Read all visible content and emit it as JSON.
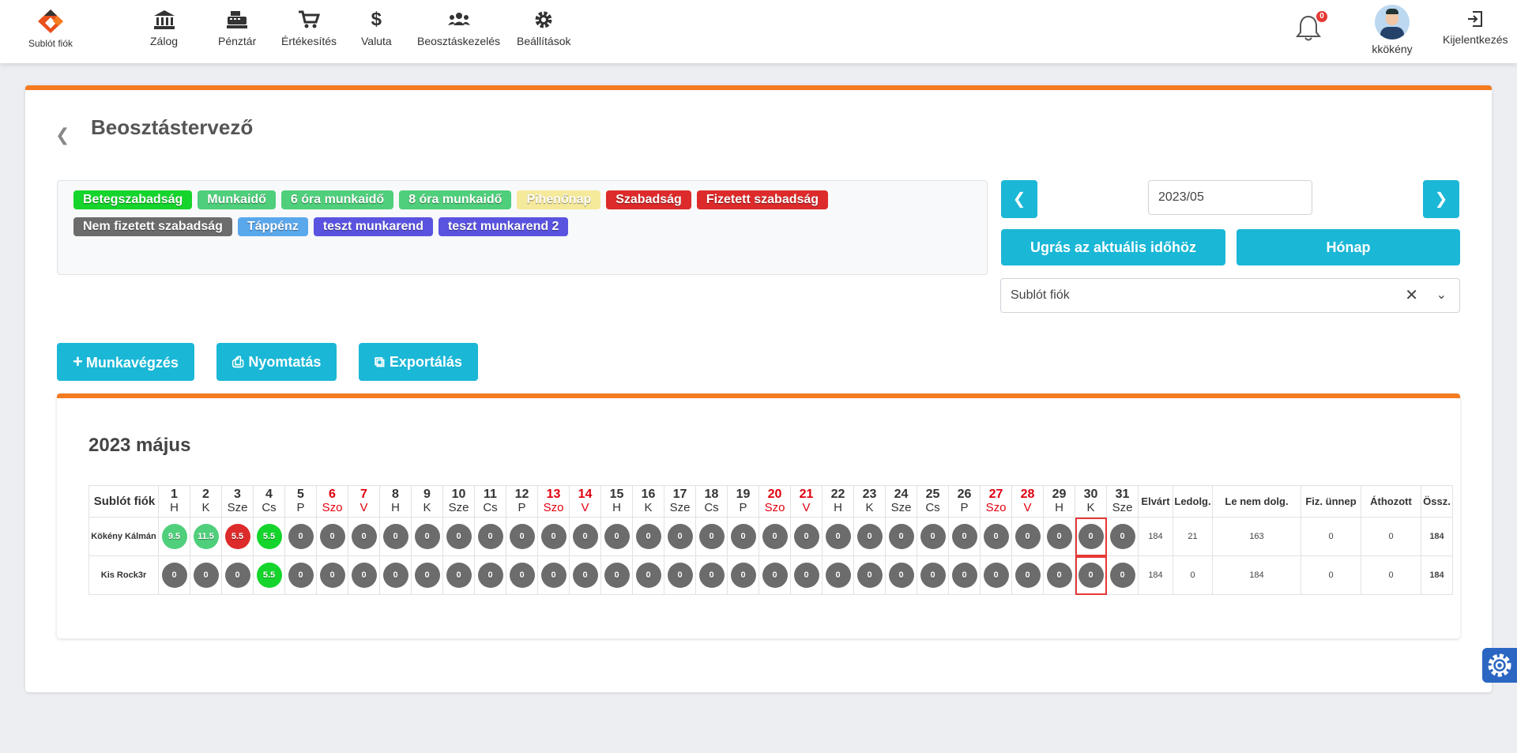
{
  "brand": {
    "label": "Sublót fiók"
  },
  "nav": [
    {
      "label": "Zálog",
      "icon": "bank-icon"
    },
    {
      "label": "Pénztár",
      "icon": "cash-register-icon"
    },
    {
      "label": "Értékesítés",
      "icon": "cart-icon"
    },
    {
      "label": "Valuta",
      "icon": "dollar-icon"
    },
    {
      "label": "Beosztáskezelés",
      "icon": "users-icon"
    },
    {
      "label": "Beállítások",
      "icon": "gear-icon"
    }
  ],
  "notifications": {
    "count": "0"
  },
  "user": {
    "name": "kkökény"
  },
  "logout": {
    "label": "Kijelentkezés"
  },
  "page": {
    "title": "Beosztástervező"
  },
  "legend": {
    "row1": [
      {
        "label": "Betegszabadság",
        "color": "#15d52c"
      },
      {
        "label": "Munkaidő",
        "color": "#4fcf7b"
      },
      {
        "label": "6 óra munkaidő",
        "color": "#4fcf7b"
      },
      {
        "label": "8 óra munkaidő",
        "color": "#4fcf7b"
      },
      {
        "label": "Pihenőnap",
        "color": "#f5e99b"
      },
      {
        "label": "Szabadság",
        "color": "#dd2a2a"
      },
      {
        "label": "Fizetett szabadság",
        "color": "#dd2a2a"
      }
    ],
    "row2": [
      {
        "label": "Nem fizetett szabadság",
        "color": "#6c6c6c"
      },
      {
        "label": "Táppénz",
        "color": "#5aa8ec"
      },
      {
        "label": "teszt munkarend",
        "color": "#5a53e0"
      },
      {
        "label": "teszt munkarend 2",
        "color": "#5a53e0"
      }
    ]
  },
  "period": {
    "value": "2023/05",
    "jump_label": "Ugrás az aktuális időhöz",
    "view_label": "Hónap"
  },
  "branch_select": {
    "value": "Sublót fiók"
  },
  "actions": {
    "work_label": "Munkavégzés",
    "print_label": "Nyomtatás",
    "export_label": "Exportálás"
  },
  "schedule": {
    "title": "2023 május",
    "branch_header": "Sublót fiók",
    "days": [
      {
        "n": "1",
        "w": "H",
        "we": false
      },
      {
        "n": "2",
        "w": "K",
        "we": false
      },
      {
        "n": "3",
        "w": "Sze",
        "we": false
      },
      {
        "n": "4",
        "w": "Cs",
        "we": false
      },
      {
        "n": "5",
        "w": "P",
        "we": false
      },
      {
        "n": "6",
        "w": "Szo",
        "we": true
      },
      {
        "n": "7",
        "w": "V",
        "we": true
      },
      {
        "n": "8",
        "w": "H",
        "we": false
      },
      {
        "n": "9",
        "w": "K",
        "we": false
      },
      {
        "n": "10",
        "w": "Sze",
        "we": false
      },
      {
        "n": "11",
        "w": "Cs",
        "we": false
      },
      {
        "n": "12",
        "w": "P",
        "we": false
      },
      {
        "n": "13",
        "w": "Szo",
        "we": true
      },
      {
        "n": "14",
        "w": "V",
        "we": true
      },
      {
        "n": "15",
        "w": "H",
        "we": false
      },
      {
        "n": "16",
        "w": "K",
        "we": false
      },
      {
        "n": "17",
        "w": "Sze",
        "we": false
      },
      {
        "n": "18",
        "w": "Cs",
        "we": false
      },
      {
        "n": "19",
        "w": "P",
        "we": false
      },
      {
        "n": "20",
        "w": "Szo",
        "we": true
      },
      {
        "n": "21",
        "w": "V",
        "we": true
      },
      {
        "n": "22",
        "w": "H",
        "we": false
      },
      {
        "n": "23",
        "w": "K",
        "we": false
      },
      {
        "n": "24",
        "w": "Sze",
        "we": false
      },
      {
        "n": "25",
        "w": "Cs",
        "we": false
      },
      {
        "n": "26",
        "w": "P",
        "we": false
      },
      {
        "n": "27",
        "w": "Szo",
        "we": true
      },
      {
        "n": "28",
        "w": "V",
        "we": true
      },
      {
        "n": "29",
        "w": "H",
        "we": false
      },
      {
        "n": "30",
        "w": "K",
        "we": false
      },
      {
        "n": "31",
        "w": "Sze",
        "we": false
      }
    ],
    "summary_headers": [
      "Elvárt",
      "Ledolg.",
      "Le nem dolg.",
      "Fiz. ünnep",
      "Áthozott",
      "Össz."
    ],
    "highlight_day": "30",
    "rows": [
      {
        "name": "Kökény Kálmán",
        "cells": [
          {
            "v": "9.5",
            "c": "#4fcf7b"
          },
          {
            "v": "11.5",
            "c": "#4fcf7b"
          },
          {
            "v": "5.5",
            "c": "#dd2a2a"
          },
          {
            "v": "5.5",
            "c": "#15d52c"
          },
          {
            "v": "0",
            "c": "#6c6c6c"
          },
          {
            "v": "0",
            "c": "#6c6c6c"
          },
          {
            "v": "0",
            "c": "#6c6c6c"
          },
          {
            "v": "0",
            "c": "#6c6c6c"
          },
          {
            "v": "0",
            "c": "#6c6c6c"
          },
          {
            "v": "0",
            "c": "#6c6c6c"
          },
          {
            "v": "0",
            "c": "#6c6c6c"
          },
          {
            "v": "0",
            "c": "#6c6c6c"
          },
          {
            "v": "0",
            "c": "#6c6c6c"
          },
          {
            "v": "0",
            "c": "#6c6c6c"
          },
          {
            "v": "0",
            "c": "#6c6c6c"
          },
          {
            "v": "0",
            "c": "#6c6c6c"
          },
          {
            "v": "0",
            "c": "#6c6c6c"
          },
          {
            "v": "0",
            "c": "#6c6c6c"
          },
          {
            "v": "0",
            "c": "#6c6c6c"
          },
          {
            "v": "0",
            "c": "#6c6c6c"
          },
          {
            "v": "0",
            "c": "#6c6c6c"
          },
          {
            "v": "0",
            "c": "#6c6c6c"
          },
          {
            "v": "0",
            "c": "#6c6c6c"
          },
          {
            "v": "0",
            "c": "#6c6c6c"
          },
          {
            "v": "0",
            "c": "#6c6c6c"
          },
          {
            "v": "0",
            "c": "#6c6c6c"
          },
          {
            "v": "0",
            "c": "#6c6c6c"
          },
          {
            "v": "0",
            "c": "#6c6c6c"
          },
          {
            "v": "0",
            "c": "#6c6c6c"
          },
          {
            "v": "0",
            "c": "#6c6c6c"
          },
          {
            "v": "0",
            "c": "#6c6c6c"
          }
        ],
        "summary": [
          "184",
          "21",
          "163",
          "0",
          "0",
          "184"
        ]
      },
      {
        "name": "Kis Rock3r",
        "cells": [
          {
            "v": "0",
            "c": "#6c6c6c"
          },
          {
            "v": "0",
            "c": "#6c6c6c"
          },
          {
            "v": "0",
            "c": "#6c6c6c"
          },
          {
            "v": "5.5",
            "c": "#15d52c"
          },
          {
            "v": "0",
            "c": "#6c6c6c"
          },
          {
            "v": "0",
            "c": "#6c6c6c"
          },
          {
            "v": "0",
            "c": "#6c6c6c"
          },
          {
            "v": "0",
            "c": "#6c6c6c"
          },
          {
            "v": "0",
            "c": "#6c6c6c"
          },
          {
            "v": "0",
            "c": "#6c6c6c"
          },
          {
            "v": "0",
            "c": "#6c6c6c"
          },
          {
            "v": "0",
            "c": "#6c6c6c"
          },
          {
            "v": "0",
            "c": "#6c6c6c"
          },
          {
            "v": "0",
            "c": "#6c6c6c"
          },
          {
            "v": "0",
            "c": "#6c6c6c"
          },
          {
            "v": "0",
            "c": "#6c6c6c"
          },
          {
            "v": "0",
            "c": "#6c6c6c"
          },
          {
            "v": "0",
            "c": "#6c6c6c"
          },
          {
            "v": "0",
            "c": "#6c6c6c"
          },
          {
            "v": "0",
            "c": "#6c6c6c"
          },
          {
            "v": "0",
            "c": "#6c6c6c"
          },
          {
            "v": "0",
            "c": "#6c6c6c"
          },
          {
            "v": "0",
            "c": "#6c6c6c"
          },
          {
            "v": "0",
            "c": "#6c6c6c"
          },
          {
            "v": "0",
            "c": "#6c6c6c"
          },
          {
            "v": "0",
            "c": "#6c6c6c"
          },
          {
            "v": "0",
            "c": "#6c6c6c"
          },
          {
            "v": "0",
            "c": "#6c6c6c"
          },
          {
            "v": "0",
            "c": "#6c6c6c"
          },
          {
            "v": "0",
            "c": "#6c6c6c"
          },
          {
            "v": "0",
            "c": "#6c6c6c"
          }
        ],
        "summary": [
          "184",
          "0",
          "184",
          "0",
          "0",
          "184"
        ]
      }
    ]
  },
  "colors": {
    "accent": "#1ab7d6",
    "brand_orange": "#f47b20",
    "weekend": "#e0000f",
    "highlight": "#e53935"
  }
}
